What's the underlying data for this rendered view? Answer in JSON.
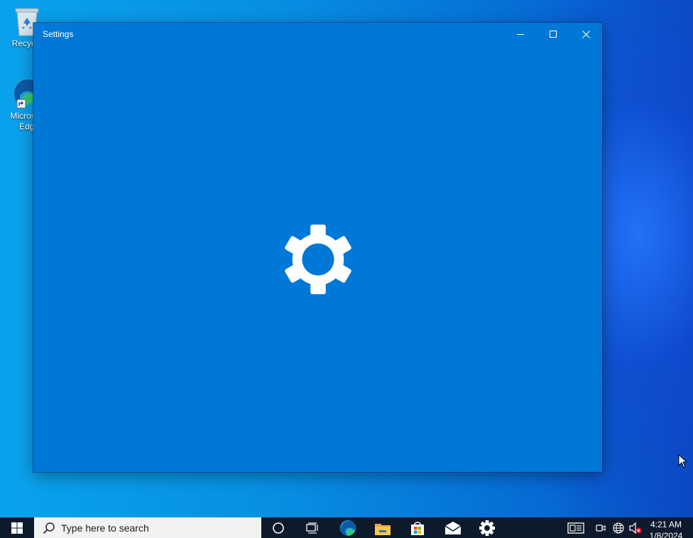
{
  "desktop": {
    "icons": [
      {
        "label": "Recycle",
        "icon": "recycle-bin-icon"
      },
      {
        "label": "Micros",
        "label2": "Edge",
        "icon": "edge-icon"
      }
    ]
  },
  "window": {
    "title": "Settings",
    "controls": [
      "minimize-icon",
      "maximize-icon",
      "close-icon"
    ],
    "background_color": "#0078d7",
    "splash_icon": "gear-icon"
  },
  "taskbar": {
    "start_icon": "windows-start-icon",
    "search": {
      "placeholder": "Type here to search"
    },
    "apps": [
      "cortana-icon",
      "task-view-icon",
      "edge-icon",
      "file-explorer-icon",
      "microsoft-store-icon",
      "mail-icon",
      "settings-gear-icon"
    ],
    "tray": [
      "news-icon",
      "meet-now-icon",
      "network-icon",
      "volume-muted-icon"
    ],
    "clock": {
      "time": "4:21 AM",
      "date": "1/8/2024"
    }
  }
}
